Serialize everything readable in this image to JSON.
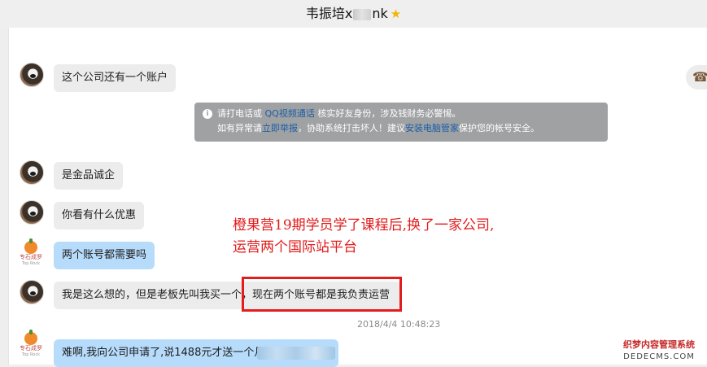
{
  "window": {
    "title_part1": "韦振培x",
    "title_part2": "nk",
    "star_icon": "★",
    "phone_icon": "☎"
  },
  "messages": [
    {
      "text": "这个公司还有一个账户"
    },
    {
      "text": "是金品诚企"
    },
    {
      "text": "你看有什么优惠"
    },
    {
      "text": "两个账号都需要吗"
    },
    {
      "text_part1": "我是这么想的，但是老板先叫我买一个，",
      "text_part2": "现在两个账号都是我负责运营"
    },
    {
      "text": "难啊,我向公司申请了,说1488元才送一个月"
    }
  ],
  "avatars": {
    "brand_name": "专石成罗",
    "brand_sub": "Top Rock"
  },
  "notice": {
    "line1_a": "请打电话或",
    "line1_link": "QQ视频通话",
    "line1_b": "核实好友身份，涉及钱财务必警惕。",
    "line2_a": "如有异常请",
    "line2_link1": "立即举报",
    "line2_b": "，协助系统打击坏人！建议",
    "line2_link2": "安装电脑管家",
    "line2_c": "保护您的帐号安全。"
  },
  "timestamp": "2018/4/4 10:48:23",
  "annotation": {
    "line1": "橙果营19期学员学了课程后,换了一家公司,",
    "line2": "运营两个国际站平台"
  },
  "watermark": {
    "line1": "织梦内容管理系统",
    "line2": "DEDECMS.COM"
  }
}
